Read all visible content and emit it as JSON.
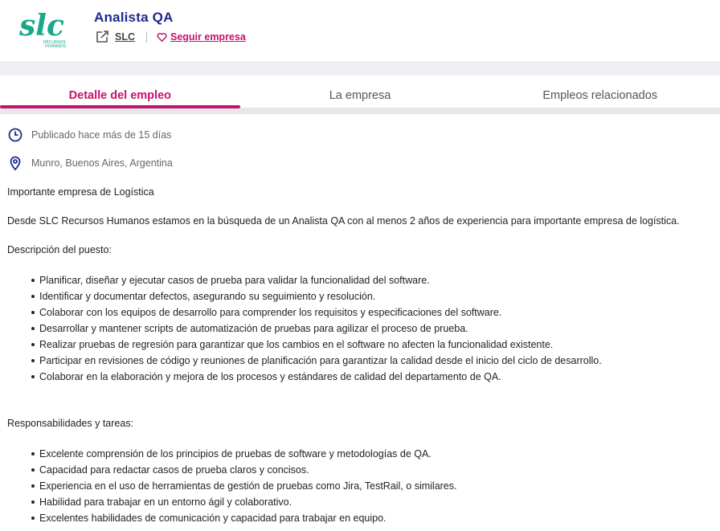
{
  "header": {
    "title": "Analista QA",
    "company_link": "SLC",
    "follow_label": "Seguir empresa",
    "logo_text": "SLC RECURSOS HUMANOS",
    "accent_color": "#c4136c",
    "title_color": "#1e2a8c",
    "logo_color": "#1aa88a"
  },
  "tabs": [
    {
      "label": "Detalle del empleo",
      "active": true
    },
    {
      "label": "La empresa",
      "active": false
    },
    {
      "label": "Empleos relacionados",
      "active": false
    }
  ],
  "meta": {
    "posted": "Publicado hace más de 15 días",
    "posted_icon": "clock-icon",
    "location": "Munro, Buenos Aires, Argentina",
    "location_icon": "location-pin-icon"
  },
  "body": {
    "intro": "Importante empresa de Logística",
    "summary": "Desde SLC Recursos Humanos estamos en la búsqueda de un Analista QA con al menos 2 años de experiencia para importante empresa de logística.",
    "description_heading": "Descripción del puesto:",
    "description_items": [
      "Planificar, diseñar y ejecutar casos de prueba para validar la funcionalidad del software.",
      "Identificar y documentar defectos, asegurando su seguimiento y resolución.",
      "Colaborar con los equipos de desarrollo para comprender los requisitos y especificaciones del software.",
      "Desarrollar y mantener scripts de automatización de pruebas para agilizar el proceso de prueba.",
      "Realizar pruebas de regresión para garantizar que los cambios en el software no afecten la funcionalidad existente.",
      "Participar en revisiones de código y reuniones de planificación para garantizar la calidad desde el inicio del ciclo de desarrollo.",
      "Colaborar en la elaboración y mejora de los procesos y estándares de calidad del departamento de QA."
    ],
    "responsibilities_heading": "Responsabilidades y tareas:",
    "responsibilities_items": [
      "Excelente comprensión de los principios de pruebas de software y metodologías de QA.",
      "Capacidad para redactar casos de prueba claros y concisos.",
      "Experiencia en el uso de herramientas de gestión de pruebas como Jira, TestRail, o similares.",
      "Habilidad para trabajar en un entorno ágil y colaborativo.",
      "Excelentes habilidades de comunicación y capacidad para trabajar en equipo."
    ]
  }
}
